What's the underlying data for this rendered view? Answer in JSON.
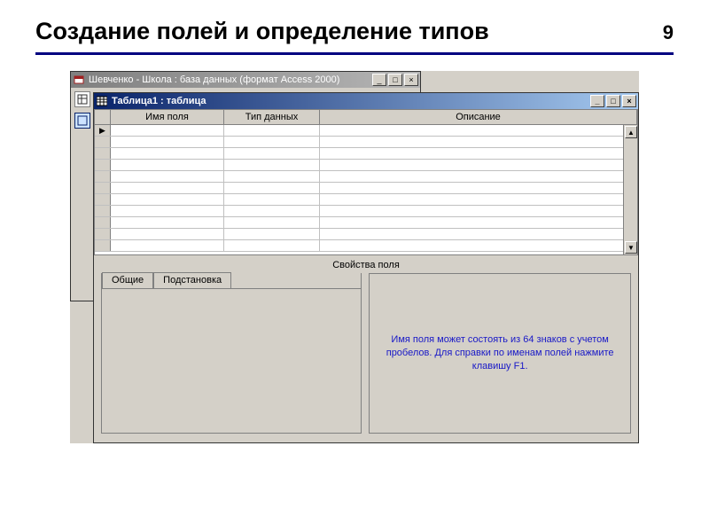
{
  "slide": {
    "title": "Создание полей и определение типов",
    "page_number": "9"
  },
  "back_window": {
    "title": "Шевченко - Школа : база данных (формат Access 2000)",
    "buttons": {
      "min": "_",
      "max": "□",
      "close": "×"
    },
    "side_icons": [
      "table-icon",
      "form-icon"
    ]
  },
  "front_window": {
    "title": "Таблица1 : таблица",
    "buttons": {
      "min": "_",
      "max": "□",
      "close": "×"
    },
    "columns": {
      "name": "Имя поля",
      "type": "Тип данных",
      "desc": "Описание"
    },
    "row_selector_marker": "▶",
    "blank_rows": 11,
    "props_label": "Свойства поля",
    "tabs": {
      "general": "Общие",
      "lookup": "Подстановка"
    },
    "hint": "Имя поля может состоять из 64 знаков с учетом пробелов.  Для справки по именам полей нажмите клавишу F1."
  }
}
